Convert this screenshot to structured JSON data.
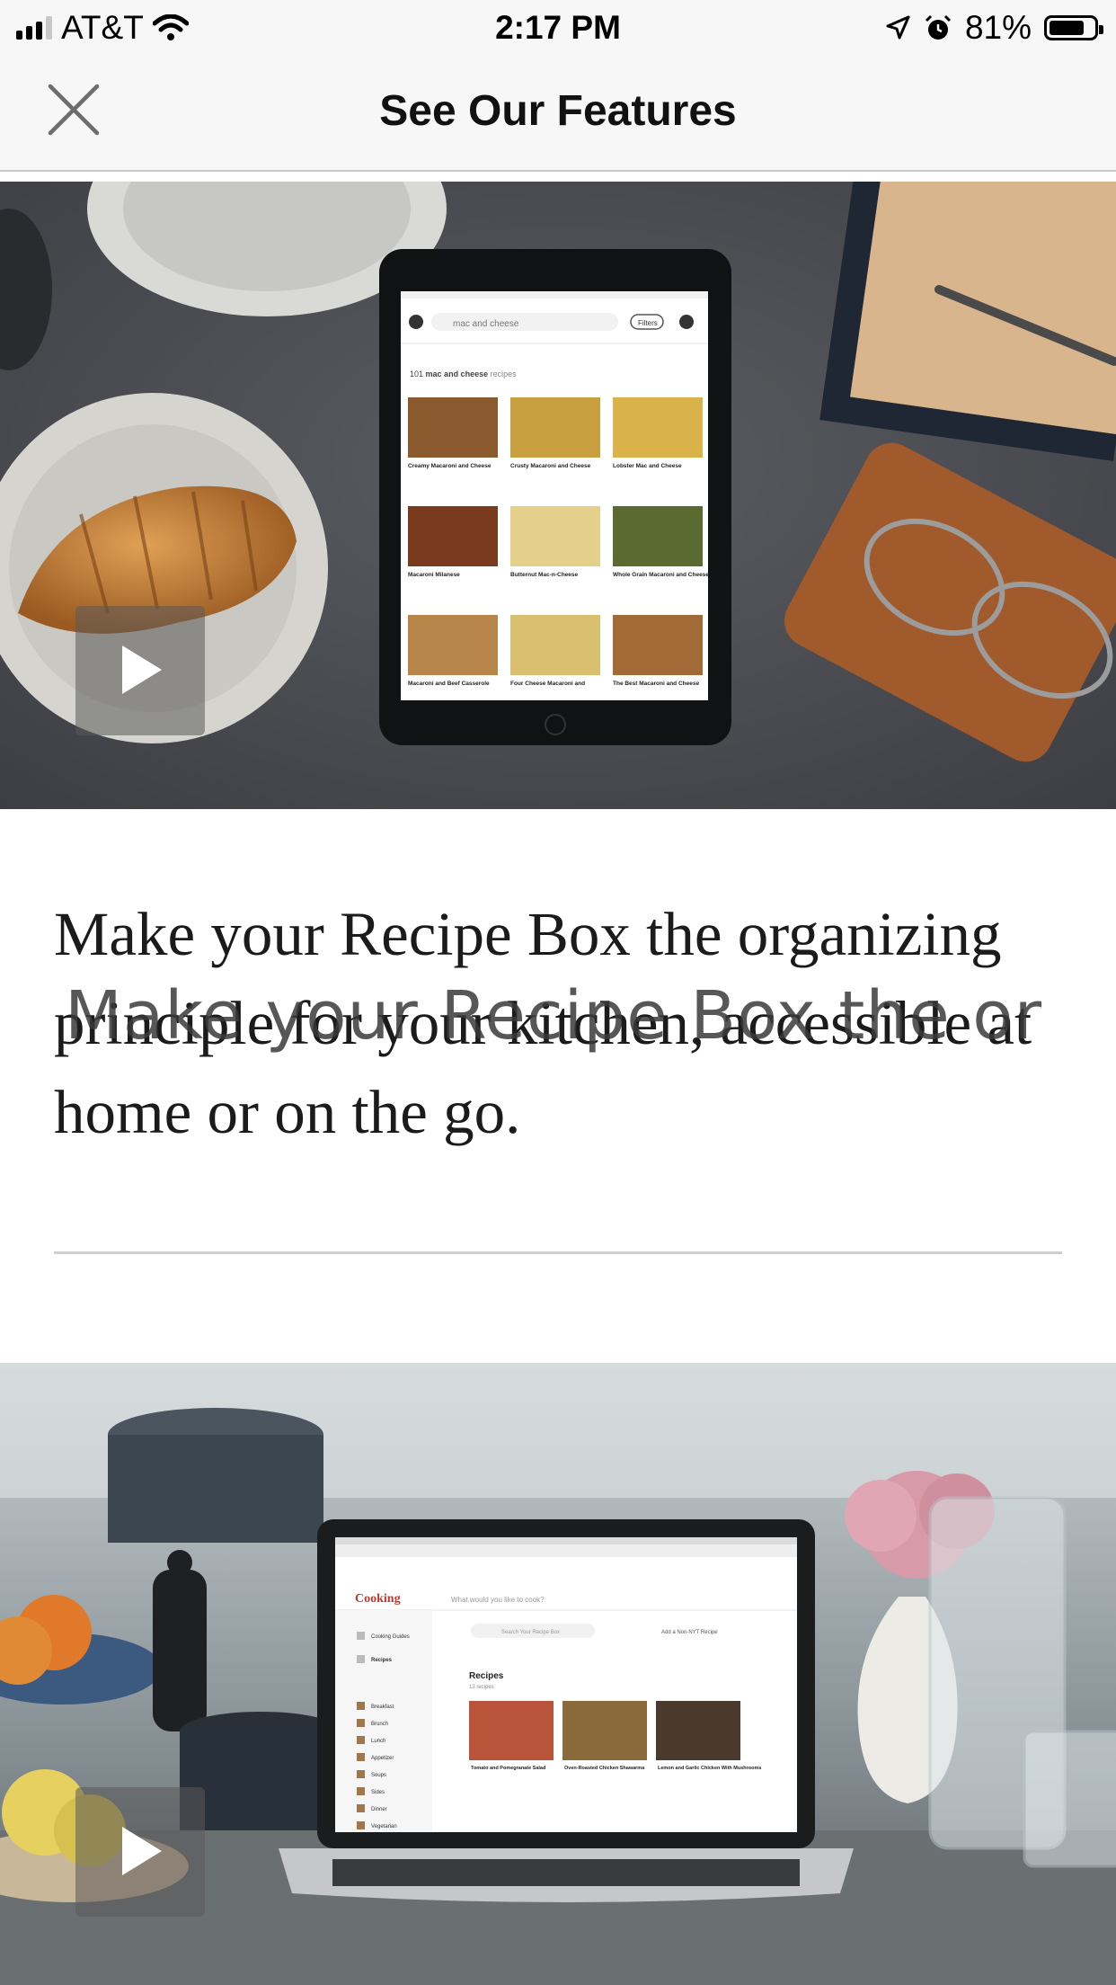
{
  "status_bar": {
    "carrier": "AT&T",
    "time": "2:17 PM",
    "battery": "81%",
    "battery_level": 0.81
  },
  "nav": {
    "title": "See Our Features",
    "close_icon": "close-icon"
  },
  "features": [
    {
      "media": "tablet-recipe-search-photo",
      "play_icon": "play-icon",
      "description": "Make your Recipe Box the organizing principle for your kitchen, accessible at home or on the go.",
      "overlay_text": "Make your Recipe Box the or"
    },
    {
      "media": "laptop-recipe-box-photo",
      "play_icon": "play-icon"
    }
  ],
  "tablet_screen": {
    "search_query": "mac and cheese",
    "filters_label": "Filters",
    "results_count": "101",
    "results_query": "mac and cheese",
    "results_suffix": "recipes",
    "recipes": [
      "Creamy Macaroni and Cheese",
      "Crusty Macaroni and Cheese",
      "Lobster Mac and Cheese",
      "Macaroni Milanese",
      "Butternut Mac-n-Cheese",
      "Whole Grain Macaroni and Cheese",
      "Macaroni and Beef Casserole",
      "Four Cheese Macaroni and",
      "The Best Macaroni and Cheese"
    ]
  },
  "laptop_screen": {
    "brand": "Cooking",
    "search_placeholder": "What would you like to cook?",
    "sidebar": [
      "Cooking Guides",
      "Recipes",
      "Breakfast",
      "Brunch",
      "Lunch",
      "Appetizer",
      "Soups",
      "Sides",
      "Dinner",
      "Vegetarian"
    ],
    "section_title": "Recipes",
    "section_count": "13 recipes",
    "add_label": "Add a Non-NYT Recipe",
    "search_box_label": "Search Your Recipe Box",
    "recipes": [
      "Tomato and Pomegranate Salad",
      "Oven-Roasted Chicken Shawarma",
      "Lemon and Garlic Chicken With Mushrooms"
    ]
  }
}
